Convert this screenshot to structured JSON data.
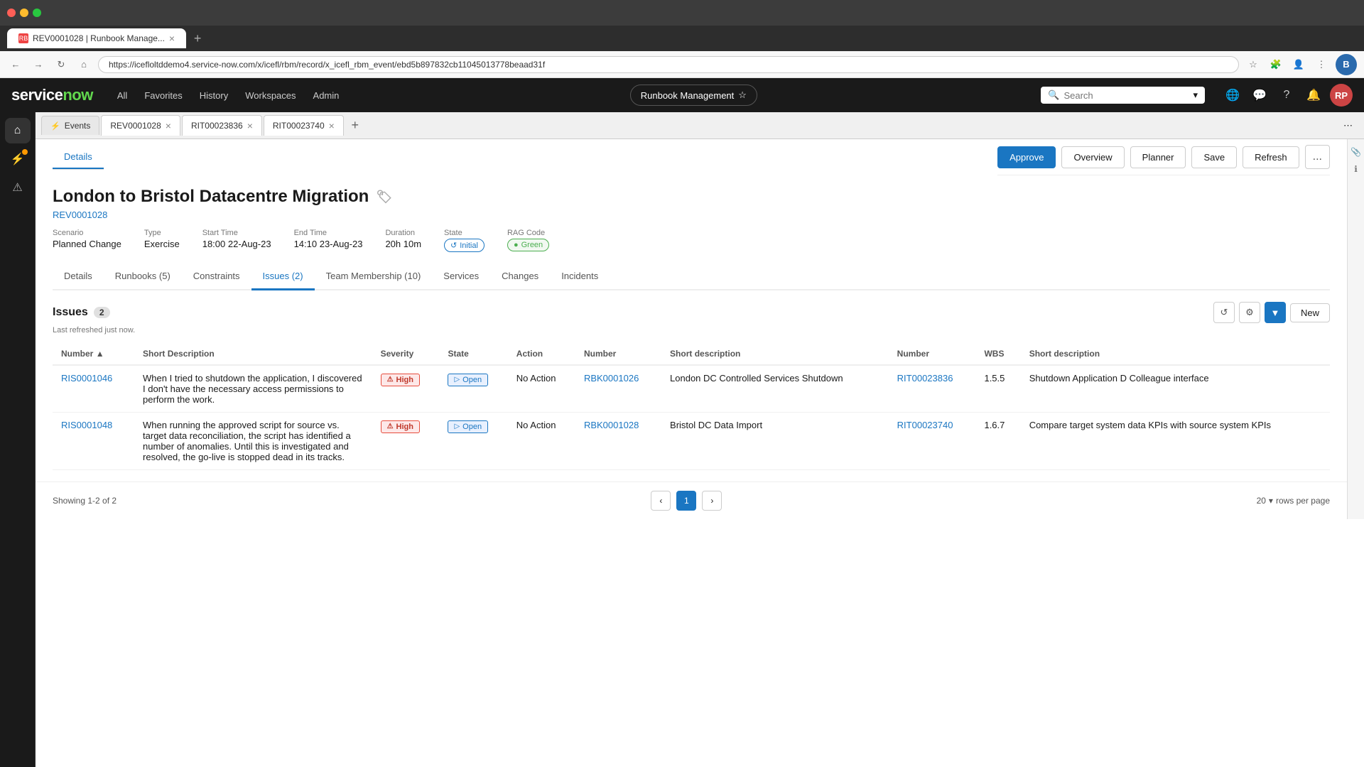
{
  "browser": {
    "tab_title": "REV0001028 | Runbook Manage...",
    "url": "https://icefloltddemo4.service-now.com/x/icefl/rbm/record/x_icefl_rbm_event/ebd5b897832cb11045013778beaad31f",
    "tab_icon": "RB"
  },
  "nav": {
    "logo": "servicenow",
    "items": [
      "All",
      "Favorites",
      "History",
      "Workspaces",
      "Admin"
    ],
    "app_badge": "Runbook Management",
    "search_placeholder": "Search",
    "avatar_initials": "RP"
  },
  "app_tabs": [
    {
      "id": "events",
      "label": "Events",
      "icon": "⚡",
      "closeable": false
    },
    {
      "id": "rev0001028",
      "label": "REV0001028",
      "icon": "",
      "closeable": true
    },
    {
      "id": "rit23836",
      "label": "RIT00023836",
      "icon": "",
      "closeable": true
    },
    {
      "id": "rit23740",
      "label": "RIT00023740",
      "icon": "",
      "closeable": true
    }
  ],
  "record": {
    "sub_tabs": [
      "Details"
    ],
    "title": "London to Bristol Datacentre Migration",
    "number": "REV0001028",
    "meta": {
      "scenario_label": "Scenario",
      "scenario_value": "Planned Change",
      "type_label": "Type",
      "type_value": "Exercise",
      "start_time_label": "Start Time",
      "start_time_value": "18:00 22-Aug-23",
      "end_time_label": "End Time",
      "end_time_value": "14:10 23-Aug-23",
      "duration_label": "Duration",
      "duration_value": "20h 10m",
      "state_label": "State",
      "state_value": "Initial",
      "rag_label": "RAG Code",
      "rag_value": "Green"
    },
    "action_buttons": {
      "approve": "Approve",
      "overview": "Overview",
      "planner": "Planner",
      "save": "Save",
      "refresh": "Refresh",
      "more": "..."
    },
    "tabs": [
      "Details",
      "Runbooks (5)",
      "Constraints",
      "Issues (2)",
      "Team Membership (10)",
      "Services",
      "Changes",
      "Incidents"
    ],
    "active_tab": "Issues (2)"
  },
  "issues": {
    "title": "Issues",
    "count": 2,
    "count_badge": "2",
    "last_refresh": "Last refreshed just now.",
    "new_button": "New",
    "columns": {
      "number": "Number",
      "short_description": "Short Description",
      "severity": "Severity",
      "state": "State",
      "action": "Action",
      "runbook_number": "Number",
      "runbook_short_desc": "Short description",
      "rit_number": "Number",
      "wbs": "WBS",
      "rit_short_desc": "Short description"
    },
    "rows": [
      {
        "id": "RIS0001046",
        "number": "RIS0001046",
        "short_description": "When I tried to shutdown the application, I discovered I don't have the necessary access permissions to perform the work.",
        "severity": "High",
        "state": "Open",
        "action": "No Action",
        "runbook_number": "RBK0001026",
        "runbook_short_desc": "London DC Controlled Services Shutdown",
        "rit_number": "RIT00023836",
        "wbs": "1.5.5",
        "rit_short_desc": "Shutdown Application D Colleague interface"
      },
      {
        "id": "RIS0001048",
        "number": "RIS0001048",
        "short_description": "When running the approved script for source vs. target data reconciliation, the script has identified a number of anomalies. Until this is investigated and resolved, the go-live is stopped dead in its tracks.",
        "severity": "High",
        "state": "Open",
        "action": "No Action",
        "runbook_number": "RBK0001028",
        "runbook_short_desc": "Bristol DC Data Import",
        "rit_number": "RIT00023740",
        "wbs": "1.6.7",
        "rit_short_desc": "Compare target system data KPIs with source system KPIs"
      }
    ]
  },
  "pagination": {
    "showing": "Showing 1-2 of 2",
    "page": "1",
    "rows_per_page": "20",
    "rows_per_page_label": "rows per page"
  }
}
